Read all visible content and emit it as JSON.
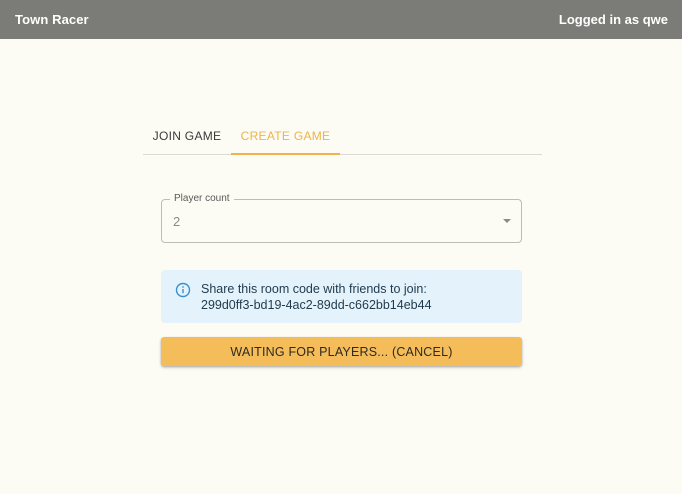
{
  "app": {
    "title": "Town Racer",
    "user_status": "Logged in as qwe"
  },
  "tabs": [
    {
      "label": "JOIN GAME",
      "selected": false
    },
    {
      "label": "CREATE GAME",
      "selected": true
    }
  ],
  "player_count": {
    "label": "Player count",
    "value": "2"
  },
  "info": {
    "icon": "info-icon",
    "line1": "Share this room code with friends to join:",
    "room_code": "299d0ff3-bd19-4ac2-89dd-c662bb14eb44"
  },
  "action_button": {
    "label": "WAITING FOR PLAYERS... (CANCEL)"
  },
  "colors": {
    "accent": "#f0b24a",
    "appbar": "#7b7b77",
    "info_bg": "#e4f2fb",
    "info_icon": "#3a8fd0",
    "background": "#fcfbf4"
  }
}
